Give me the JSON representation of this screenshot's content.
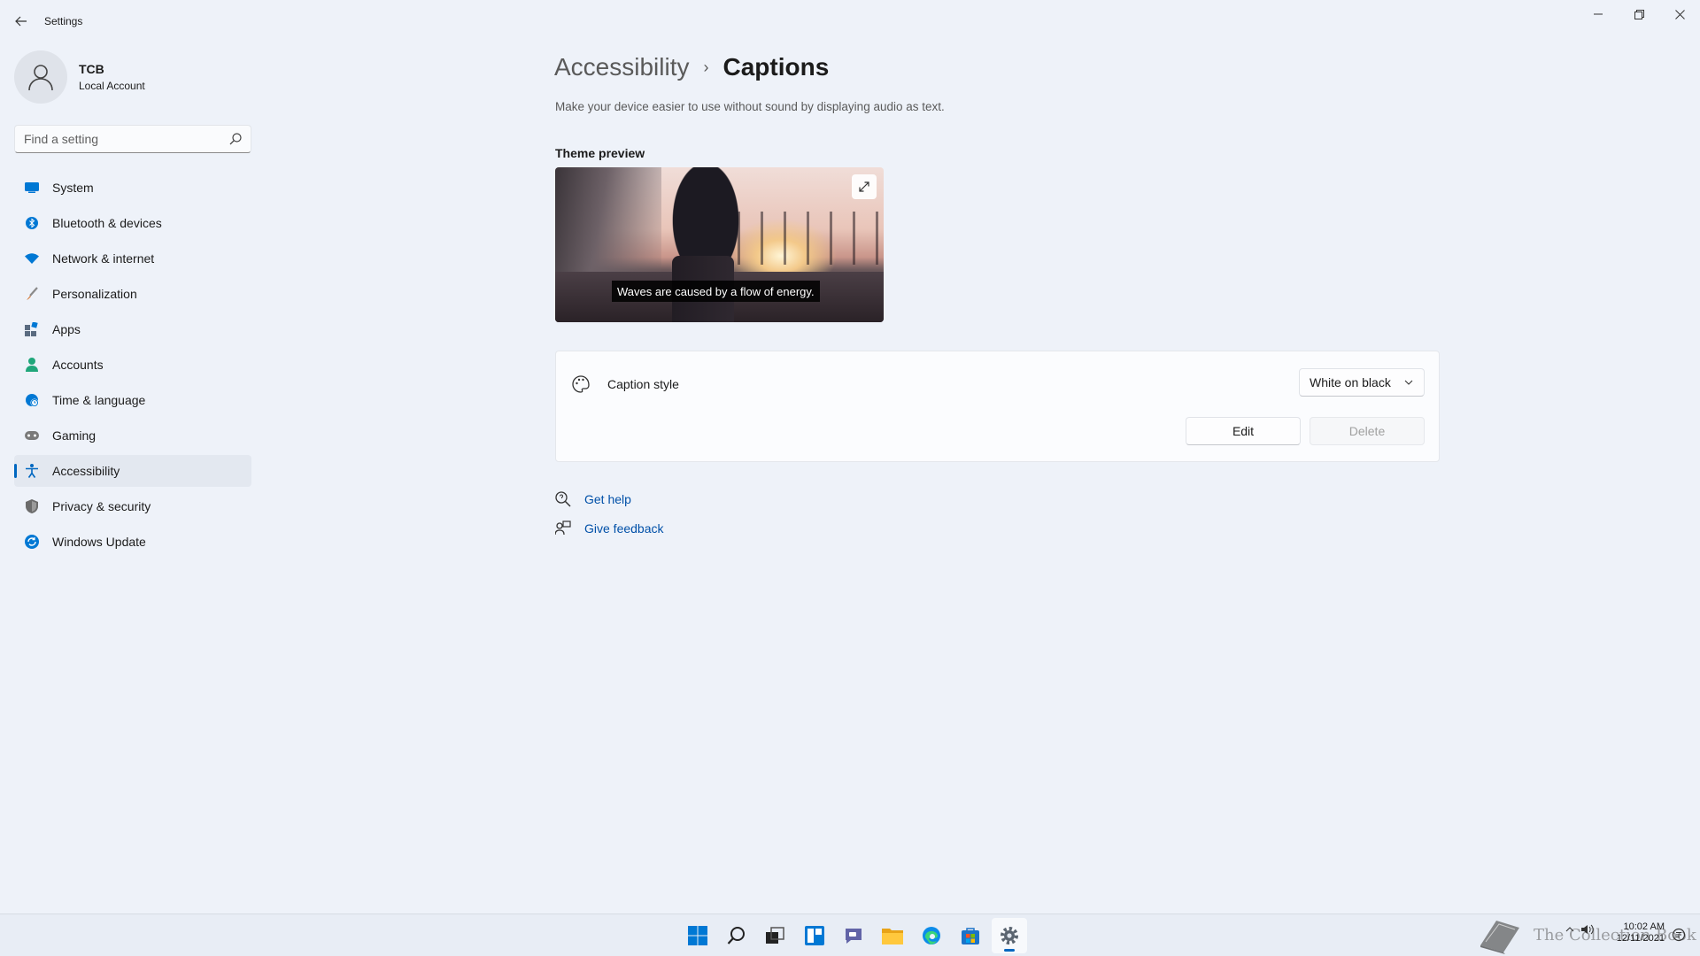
{
  "window": {
    "title": "Settings",
    "controls": {
      "minimize": "—",
      "maximize": "❐",
      "close": "✕"
    }
  },
  "profile": {
    "name": "TCB",
    "subtitle": "Local Account"
  },
  "search": {
    "placeholder": "Find a setting"
  },
  "sidebar": {
    "items": [
      {
        "label": "System",
        "icon": "system-icon",
        "color": "#0078d4"
      },
      {
        "label": "Bluetooth & devices",
        "icon": "bluetooth-icon",
        "color": "#0078d4"
      },
      {
        "label": "Network & internet",
        "icon": "wifi-icon",
        "color": "#0078d4"
      },
      {
        "label": "Personalization",
        "icon": "brush-icon",
        "color": "#d67d3e"
      },
      {
        "label": "Apps",
        "icon": "apps-icon",
        "color": "#5a6b80"
      },
      {
        "label": "Accounts",
        "icon": "accounts-icon",
        "color": "#1fa67a"
      },
      {
        "label": "Time & language",
        "icon": "globe-clock-icon",
        "color": "#0078d4"
      },
      {
        "label": "Gaming",
        "icon": "controller-icon",
        "color": "#7a7a7a"
      },
      {
        "label": "Accessibility",
        "icon": "accessibility-icon",
        "color": "#0067c0",
        "active": true
      },
      {
        "label": "Privacy & security",
        "icon": "shield-icon",
        "color": "#6b6b6b"
      },
      {
        "label": "Windows Update",
        "icon": "update-icon",
        "color": "#0078d4"
      }
    ]
  },
  "main": {
    "breadcrumb": {
      "parent": "Accessibility",
      "separator": "›",
      "current": "Captions"
    },
    "description": "Make your device easier to use without sound by displaying audio as text.",
    "theme_preview": {
      "title": "Theme preview",
      "caption_text": "Waves are caused by a flow of energy."
    },
    "caption_style": {
      "label": "Caption style",
      "selected": "White on black",
      "edit_label": "Edit",
      "delete_label": "Delete"
    },
    "links": {
      "help": "Get help",
      "feedback": "Give feedback"
    }
  },
  "taskbar": {
    "apps": [
      "start-icon",
      "search-icon",
      "task-view-icon",
      "widgets-icon",
      "chat-icon",
      "file-explorer-icon",
      "edge-icon",
      "store-icon",
      "settings-icon"
    ],
    "active_app": "settings-icon",
    "watermark": "The Collection Book",
    "time": "10:02 AM",
    "date": "12/11/2021"
  },
  "colors": {
    "accent": "#0067c0",
    "link": "#0050a8",
    "background": "#eef2f9"
  }
}
